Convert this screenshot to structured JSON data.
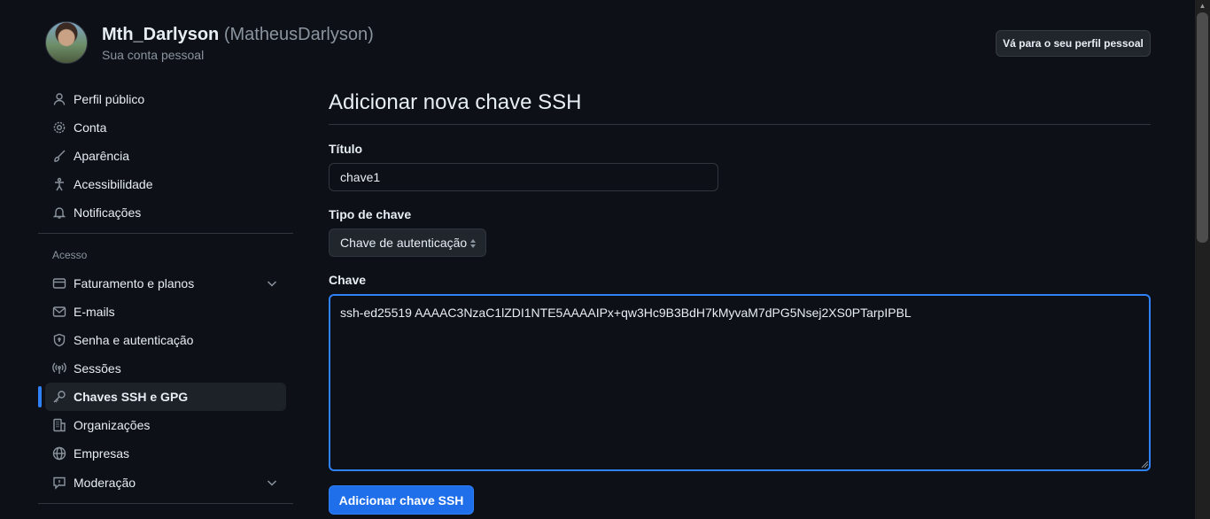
{
  "header": {
    "username": "Mth_Darlyson",
    "handle": "(MatheusDarlyson)",
    "subtitle": "Sua conta pessoal",
    "profile_button": "Vá para o seu perfil pessoal"
  },
  "sidebar": {
    "items_top": [
      {
        "label": "Perfil público",
        "icon": "person-icon"
      },
      {
        "label": "Conta",
        "icon": "gear-icon"
      },
      {
        "label": "Aparência",
        "icon": "paintbrush-icon"
      },
      {
        "label": "Acessibilidade",
        "icon": "accessibility-icon"
      },
      {
        "label": "Notificações",
        "icon": "bell-icon"
      }
    ],
    "section_heading": "Acesso",
    "items_access": [
      {
        "label": "Faturamento e planos",
        "icon": "credit-card-icon",
        "expandable": true
      },
      {
        "label": "E-mails",
        "icon": "mail-icon"
      },
      {
        "label": "Senha e autenticação",
        "icon": "shield-lock-icon"
      },
      {
        "label": "Sessões",
        "icon": "broadcast-icon"
      },
      {
        "label": "Chaves SSH e GPG",
        "icon": "key-icon",
        "active": true
      },
      {
        "label": "Organizações",
        "icon": "organization-icon"
      },
      {
        "label": "Empresas",
        "icon": "globe-icon"
      },
      {
        "label": "Moderação",
        "icon": "report-icon",
        "expandable": true
      }
    ]
  },
  "main": {
    "title": "Adicionar nova chave SSH",
    "title_label": "Título",
    "title_value": "chave1",
    "key_type_label": "Tipo de chave",
    "key_type_value": "Chave de autenticação",
    "key_label": "Chave",
    "key_value": "ssh-ed25519 AAAAC3NzaC1lZDI1NTE5AAAAIPx+qw3Hc9B3BdH7kMyvaM7dPG5Nsej2XS0PTarpIPBL",
    "submit_label": "Adicionar chave SSH"
  },
  "colors": {
    "background": "#0d1117",
    "accent": "#2f81f7",
    "button_primary": "#1f6feb",
    "muted_text": "#8b949e",
    "border": "#30363d"
  }
}
